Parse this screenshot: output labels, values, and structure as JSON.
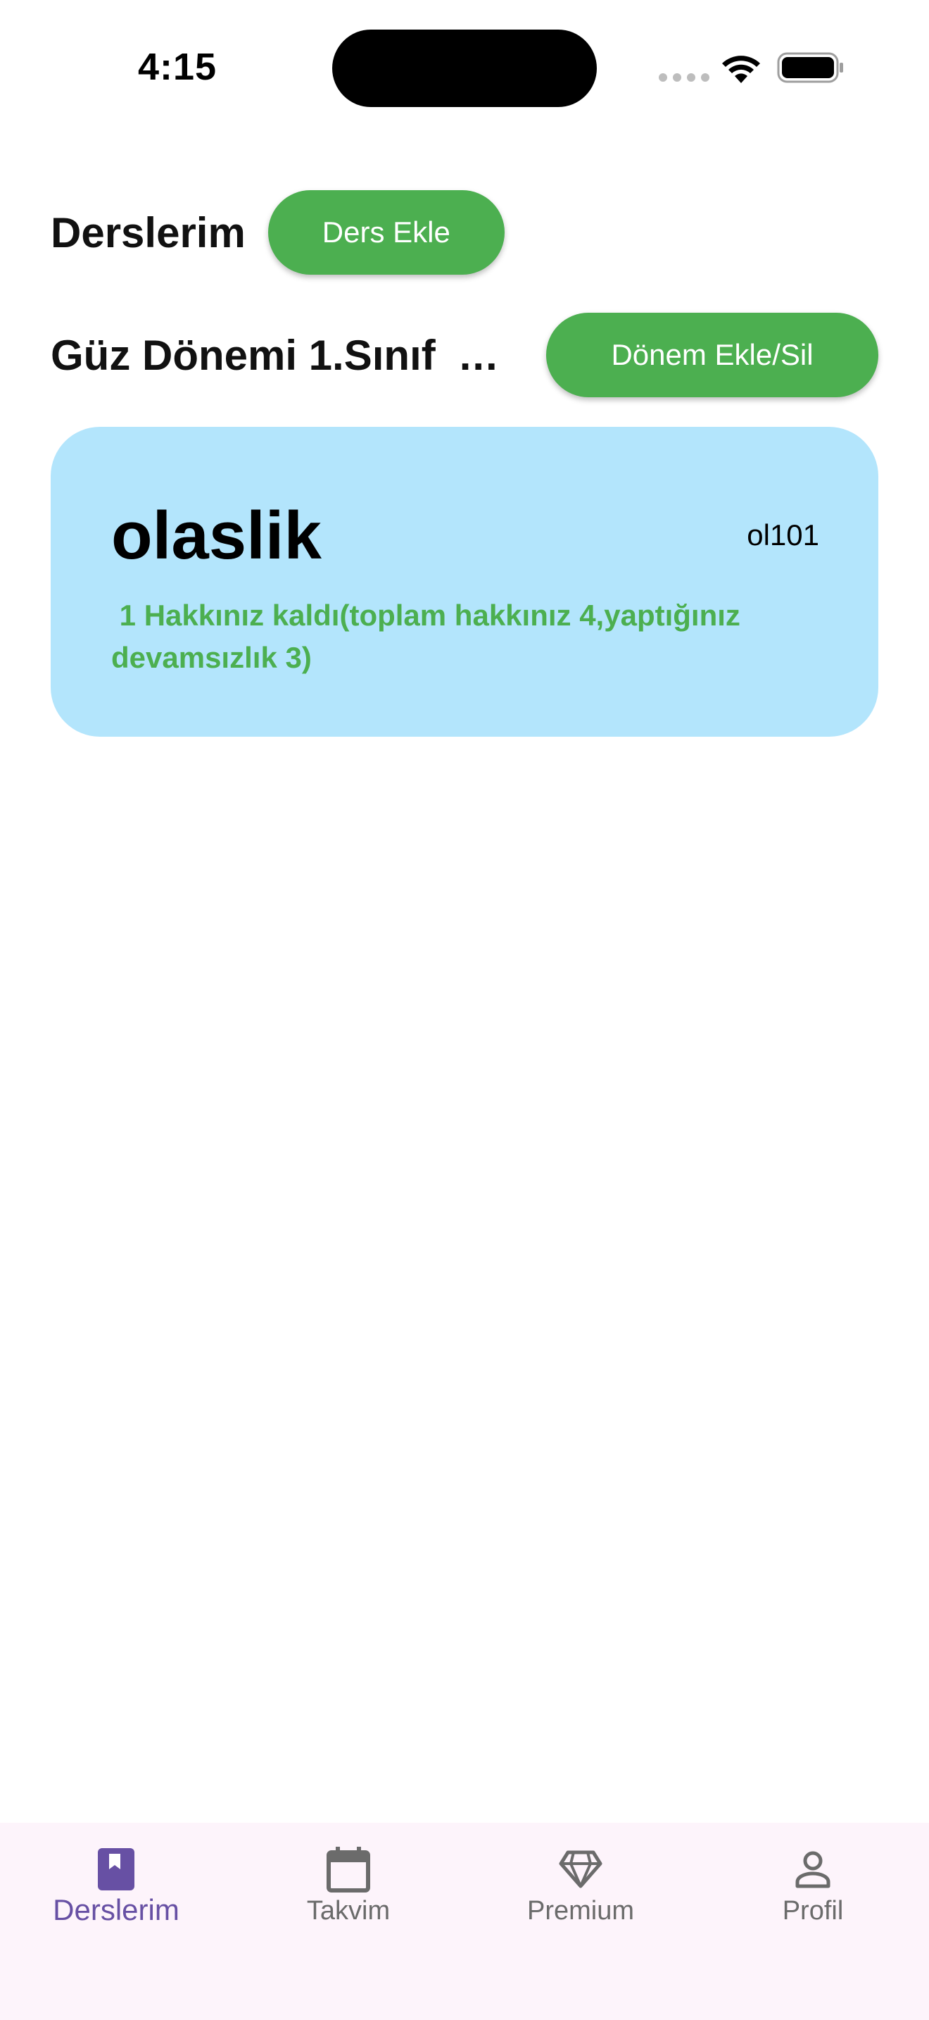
{
  "status_bar": {
    "time": "4:15"
  },
  "header": {
    "title": "Derslerim",
    "add_course_label": "Ders Ekle"
  },
  "term": {
    "selected": "Güz Dönemi 1.Sınıf",
    "ellipsis": "...",
    "add_remove_label": "Dönem Ekle/Sil"
  },
  "courses": [
    {
      "name": "olaslik",
      "code": "ol101",
      "absence_text": " 1 Hakkınız kaldı(toplam hakkınız 4,yaptığınız devamsızlık 3)",
      "card_color": "#b3e5fc",
      "text_color": "#4caf50"
    }
  ],
  "bottom_nav": {
    "items": [
      {
        "label": "Derslerim",
        "icon": "bookmark-book-icon",
        "active": true
      },
      {
        "label": "Takvim",
        "icon": "calendar-icon",
        "active": false
      },
      {
        "label": "Premium",
        "icon": "diamond-icon",
        "active": false
      },
      {
        "label": "Profil",
        "icon": "person-icon",
        "active": false
      }
    ]
  },
  "colors": {
    "accent_green": "#4caf50",
    "active_purple": "#6750a4",
    "nav_background": "#fdf4fb"
  }
}
